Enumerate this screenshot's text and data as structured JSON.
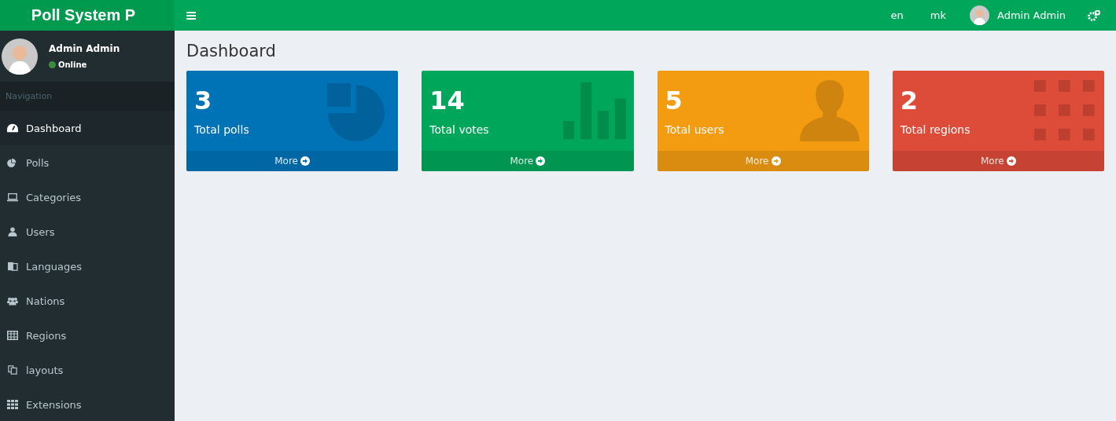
{
  "brand": "Poll System P",
  "header": {
    "languages": [
      {
        "label": "en"
      },
      {
        "label": "mk"
      }
    ],
    "user_name": "Admin Admin"
  },
  "sidebar": {
    "user_name": "Admin Admin",
    "status": "Online",
    "section": "Navigation",
    "items": [
      {
        "label": "Dashboard",
        "kind": "dashboard",
        "selected": true
      },
      {
        "label": "Polls",
        "kind": "pie",
        "selected": false
      },
      {
        "label": "Categories",
        "kind": "laptop",
        "selected": false
      },
      {
        "label": "Users",
        "kind": "user",
        "selected": false
      },
      {
        "label": "Languages",
        "kind": "language",
        "selected": false
      },
      {
        "label": "Nations",
        "kind": "users",
        "selected": false
      },
      {
        "label": "Regions",
        "kind": "table",
        "selected": false
      },
      {
        "label": "layouts",
        "kind": "copy",
        "selected": false
      },
      {
        "label": "Extensions",
        "kind": "grid",
        "selected": false
      }
    ]
  },
  "page_title": "Dashboard",
  "cards": [
    {
      "value": "3",
      "label": "Total polls",
      "link": "More",
      "kind": "pie",
      "color": "#0073b7"
    },
    {
      "value": "14",
      "label": "Total votes",
      "link": "More",
      "kind": "bars",
      "color": "#00a65a"
    },
    {
      "value": "5",
      "label": "Total users",
      "link": "More",
      "kind": "user",
      "color": "#f39c12"
    },
    {
      "value": "2",
      "label": "Total regions",
      "link": "More",
      "kind": "grid",
      "color": "#dd4b39"
    }
  ]
}
